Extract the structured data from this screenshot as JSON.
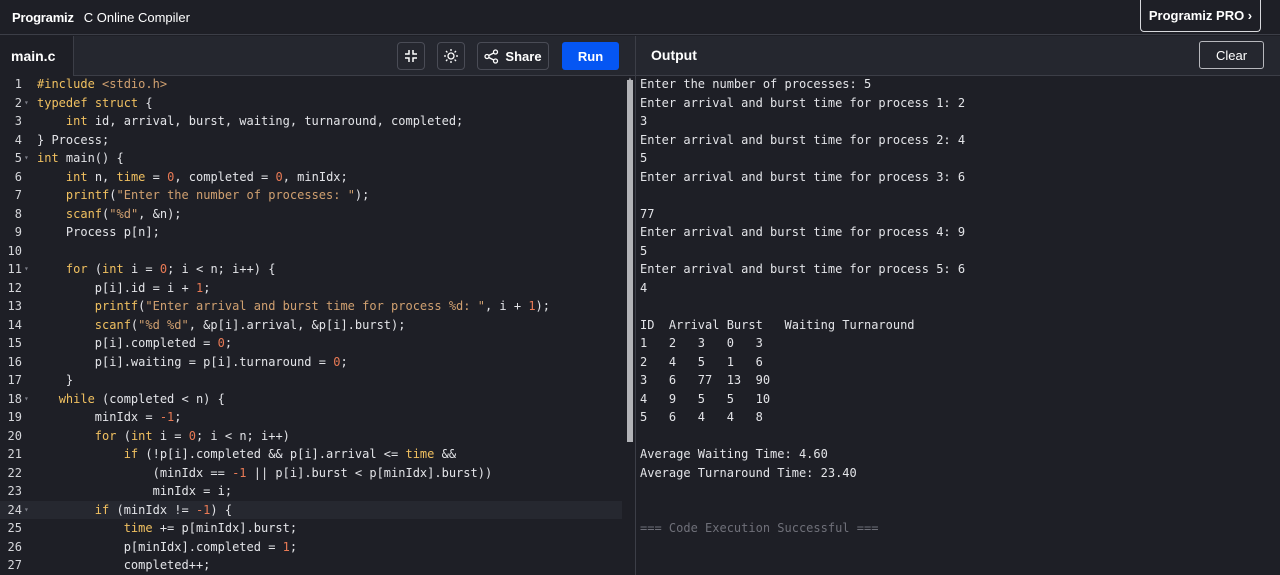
{
  "nav": {
    "brand": "Programiz",
    "title": "C Online Compiler",
    "pro_button": "Programiz PRO ›"
  },
  "editor": {
    "file_tab": "main.c",
    "share_label": "Share",
    "run_label": "Run",
    "icons": [
      "fullscreen-exit-icon",
      "theme-toggle-icon",
      "share-icon"
    ]
  },
  "output": {
    "title": "Output",
    "clear_label": "Clear",
    "lines": [
      "Enter the number of processes: 5",
      "Enter arrival and burst time for process 1: 2",
      "3",
      "Enter arrival and burst time for process 2: 4",
      "5",
      "Enter arrival and burst time for process 3: 6",
      "",
      "77",
      "Enter arrival and burst time for process 4: 9",
      "5",
      "Enter arrival and burst time for process 5: 6",
      "4",
      "",
      "ID  Arrival Burst   Waiting Turnaround",
      "1   2   3   0   3",
      "2   4   5   1   6",
      "3   6   77  13  90",
      "4   9   5   5   10",
      "5   6   4   4   8",
      "",
      "Average Waiting Time: 4.60",
      "Average Turnaround Time: 23.40",
      "",
      "",
      "=== Code Execution Successful ==="
    ]
  },
  "code_lines": [
    {
      "n": "1",
      "fold": false,
      "html": "<span class='pp'>#include</span> <span class='str'>&lt;stdio.h&gt;</span>"
    },
    {
      "n": "2",
      "fold": true,
      "html": "<span class='kw'>typedef</span> <span class='kw'>struct</span> {"
    },
    {
      "n": "3",
      "fold": false,
      "html": "    <span class='kw'>int</span> id, arrival, burst, waiting, turnaround, completed;"
    },
    {
      "n": "4",
      "fold": false,
      "html": "} Process;"
    },
    {
      "n": "5",
      "fold": true,
      "html": "<span class='kw'>int</span> main() {"
    },
    {
      "n": "6",
      "fold": false,
      "html": "    <span class='kw'>int</span> n, <span class='kw'>time</span> = <span class='num'>0</span>, completed = <span class='num'>0</span>, minIdx;"
    },
    {
      "n": "7",
      "fold": false,
      "html": "    <span class='kw'>printf</span>(<span class='str'>\"Enter the number of processes: \"</span>);"
    },
    {
      "n": "8",
      "fold": false,
      "html": "    <span class='kw'>scanf</span>(<span class='str'>\"%d\"</span>, &amp;n);"
    },
    {
      "n": "9",
      "fold": false,
      "html": "    Process p[n];"
    },
    {
      "n": "10",
      "fold": false,
      "html": ""
    },
    {
      "n": "11",
      "fold": true,
      "html": "    <span class='kw'>for</span> (<span class='kw'>int</span> i = <span class='num'>0</span>; i &lt; n; i++) {"
    },
    {
      "n": "12",
      "fold": false,
      "html": "        p[i].id = i + <span class='num'>1</span>;"
    },
    {
      "n": "13",
      "fold": false,
      "html": "        <span class='kw'>printf</span>(<span class='str'>\"Enter arrival and burst time for process %d: \"</span>, i + <span class='num'>1</span>);"
    },
    {
      "n": "14",
      "fold": false,
      "html": "        <span class='kw'>scanf</span>(<span class='str'>\"%d %d\"</span>, &amp;p[i].arrival, &amp;p[i].burst);"
    },
    {
      "n": "15",
      "fold": false,
      "html": "        p[i].completed = <span class='num'>0</span>;"
    },
    {
      "n": "16",
      "fold": false,
      "html": "        p[i].waiting = p[i].turnaround = <span class='num'>0</span>;"
    },
    {
      "n": "17",
      "fold": false,
      "html": "    }"
    },
    {
      "n": "18",
      "fold": true,
      "html": "   <span class='kw'>while</span> (completed &lt; n) {"
    },
    {
      "n": "19",
      "fold": false,
      "html": "        minIdx = <span class='num'>-1</span>;"
    },
    {
      "n": "20",
      "fold": false,
      "html": "        <span class='kw'>for</span> (<span class='kw'>int</span> i = <span class='num'>0</span>; i &lt; n; i++)"
    },
    {
      "n": "21",
      "fold": false,
      "html": "            <span class='kw'>if</span> (!p[i].completed &amp;&amp; p[i].arrival &lt;= <span class='kw'>time</span> &amp;&amp;"
    },
    {
      "n": "22",
      "fold": false,
      "html": "                (minIdx == <span class='num'>-1</span> || p[i].burst &lt; p[minIdx].burst))"
    },
    {
      "n": "23",
      "fold": false,
      "html": "                minIdx = i;"
    },
    {
      "n": "24",
      "fold": true,
      "html": "        <span class='kw'>if</span> (minIdx != <span class='num'>-1</span>) {",
      "active": true
    },
    {
      "n": "25",
      "fold": false,
      "html": "            <span class='kw'>time</span> += p[minIdx].burst;"
    },
    {
      "n": "26",
      "fold": false,
      "html": "            p[minIdx].completed = <span class='num'>1</span>;"
    },
    {
      "n": "27",
      "fold": false,
      "html": "            completed++;"
    }
  ]
}
